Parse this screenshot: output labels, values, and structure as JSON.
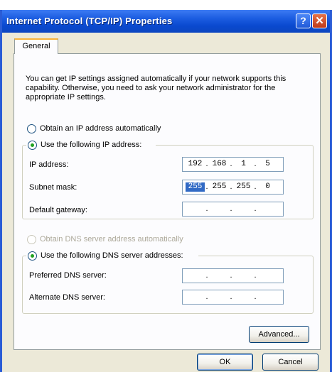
{
  "window": {
    "title": "Internet Protocol (TCP/IP) Properties",
    "help_glyph": "?",
    "close_glyph": "✕"
  },
  "tabs": [
    {
      "label": "General",
      "selected": true
    }
  ],
  "intro_text": "You can get IP settings assigned automatically if your network supports this capability. Otherwise, you need to ask your network administrator for the appropriate IP settings.",
  "ip_options": {
    "auto_label": "Obtain an IP address automatically",
    "manual_label": "Use the following IP address:",
    "selected": "manual"
  },
  "ip_fields": {
    "ip_address": {
      "label": "IP address:",
      "octets": [
        "192",
        "168",
        "1",
        "5"
      ]
    },
    "subnet_mask": {
      "label": "Subnet mask:",
      "octets": [
        "255",
        "255",
        "255",
        "0"
      ],
      "selected_octet": 0
    },
    "default_gateway": {
      "label": "Default gateway:",
      "octets": [
        "",
        "",
        "",
        ""
      ]
    }
  },
  "dns_options": {
    "auto_label": "Obtain DNS server address automatically",
    "auto_enabled": false,
    "manual_label": "Use the following DNS server addresses:",
    "selected": "manual"
  },
  "dns_fields": {
    "preferred": {
      "label": "Preferred DNS server:",
      "octets": [
        "",
        "",
        "",
        ""
      ]
    },
    "alternate": {
      "label": "Alternate DNS server:",
      "octets": [
        "",
        "",
        "",
        ""
      ]
    }
  },
  "buttons": {
    "advanced": "Advanced...",
    "ok": "OK",
    "cancel": "Cancel"
  },
  "colors": {
    "title_bar": "#0a49cf",
    "dialog_bg": "#ece9d8",
    "tab_accent": "#f8b33a",
    "radio_dot": "#21a121",
    "selection": "#316ac5"
  }
}
